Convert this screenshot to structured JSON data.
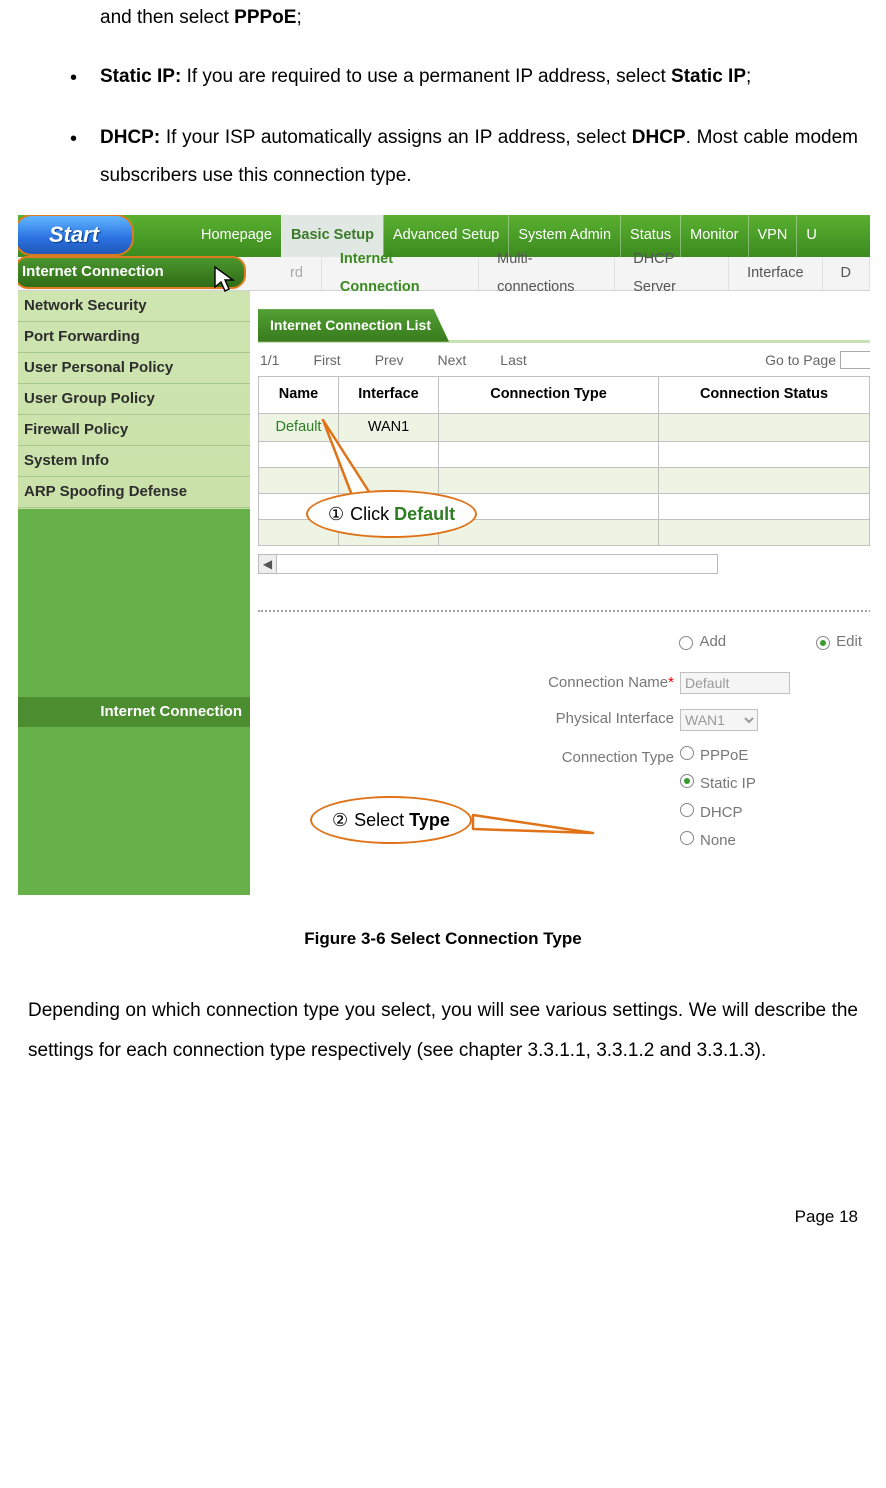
{
  "intro": {
    "line1_prefix": "and then select ",
    "line1_bold": "PPPoE",
    "line1_suffix": ";"
  },
  "bullets": {
    "staticip": {
      "label": "Static IP:",
      "text_a": " If you are required to use a permanent IP address, select ",
      "bold": "Static IP",
      "text_b": ";"
    },
    "dhcp": {
      "label": "DHCP:",
      "text_a": "  If your ISP automatically assigns an IP address, select ",
      "bold": "DHCP",
      "text_b": ". Most cable modem subscribers use this connection type."
    }
  },
  "figure": {
    "caption": "Figure 3-6 Select Connection Type",
    "start": "Start",
    "topnav": {
      "homepage": "Homepage",
      "basic": "Basic Setup",
      "advanced": "Advanced Setup",
      "system": "System Admin",
      "status": "Status",
      "monitor": "Monitor",
      "vpn": "VPN",
      "u": "U"
    },
    "subnav": {
      "left": "Internet Connection",
      "rd": "rd",
      "internet": "Internet Connection",
      "multi": "Multi-connections",
      "dhcp": "DHCP Server",
      "interface": "Interface",
      "d": "D"
    },
    "sidebar": {
      "items": [
        "Network Security",
        "Port Forwarding",
        "User Personal Policy",
        "User Group Policy",
        "Firewall Policy",
        "System Info",
        "ARP Spoofing Defense"
      ],
      "ic": "Internet Connection"
    },
    "panel": {
      "title": "Internet Connection List",
      "pager": {
        "count": "1/1",
        "first": "First",
        "prev": "Prev",
        "next": "Next",
        "last": "Last",
        "goto": "Go to Page"
      },
      "headers": {
        "name": "Name",
        "iface": "Interface",
        "ctype": "Connection Type",
        "cstatus": "Connection Status"
      },
      "row": {
        "name": "Default",
        "iface": "WAN1"
      }
    },
    "mode": {
      "add": "Add",
      "edit": "Edit"
    },
    "form": {
      "cname_lbl": "Connection Name",
      "cname_val": "Default",
      "piface_lbl": "Physical Interface",
      "piface_val": "WAN1",
      "ctype_lbl": "Connection Type",
      "opts": {
        "pppoe": "PPPoE",
        "static": "Static IP",
        "dhcp": "DHCP",
        "none": "None"
      }
    },
    "callout1": {
      "num": "①",
      "pre": " Click ",
      "word": "Default"
    },
    "callout2": {
      "num": "②",
      "pre": " Select ",
      "word": "Type"
    }
  },
  "after_para": "Depending on which connection type you select, you will see various settings. We will describe the settings for each connection type respectively (see chapter 3.3.1.1, 3.3.1.2 and 3.3.1.3).",
  "page_num": "Page  18"
}
